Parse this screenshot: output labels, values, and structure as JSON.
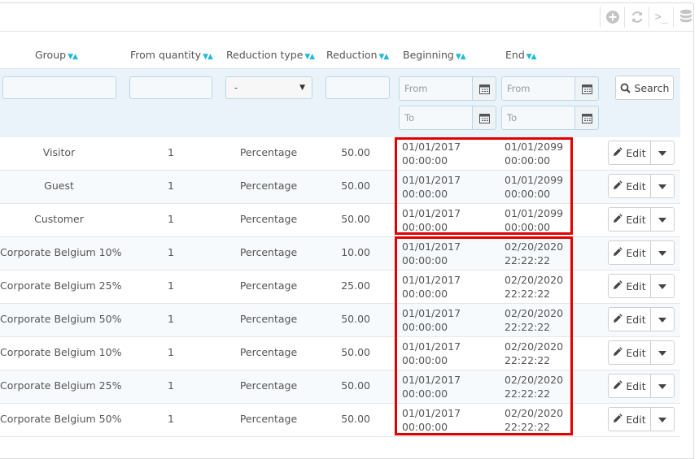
{
  "columns": {
    "group": "Group",
    "from_quantity": "From quantity",
    "reduction_type": "Reduction type",
    "reduction": "Reduction",
    "beginning": "Beginning",
    "end": "End"
  },
  "filters": {
    "reduction_type_selected": "-",
    "beginning_from_placeholder": "From",
    "beginning_to_placeholder": "To",
    "end_from_placeholder": "From",
    "end_to_placeholder": "To",
    "search_label": "Search"
  },
  "toolbar": {
    "icons": [
      "add-icon",
      "refresh-icon",
      "terminal-icon",
      "database-icon"
    ],
    "terminal_glyph": ">_"
  },
  "row_action_label": "Edit",
  "rows": [
    {
      "group": "Visitor",
      "qty": "1",
      "type": "Percentage",
      "reduction": "50.00",
      "beg_date": "01/01/2017",
      "beg_time": "00:00:00",
      "end_date": "01/01/2099",
      "end_time": "00:00:00"
    },
    {
      "group": "Guest",
      "qty": "1",
      "type": "Percentage",
      "reduction": "50.00",
      "beg_date": "01/01/2017",
      "beg_time": "00:00:00",
      "end_date": "01/01/2099",
      "end_time": "00:00:00"
    },
    {
      "group": "Customer",
      "qty": "1",
      "type": "Percentage",
      "reduction": "50.00",
      "beg_date": "01/01/2017",
      "beg_time": "00:00:00",
      "end_date": "01/01/2099",
      "end_time": "00:00:00"
    },
    {
      "group": "Corporate Belgium 10%",
      "qty": "1",
      "type": "Percentage",
      "reduction": "10.00",
      "beg_date": "01/01/2017",
      "beg_time": "00:00:00",
      "end_date": "02/20/2020",
      "end_time": "22:22:22"
    },
    {
      "group": "Corporate Belgium 25%",
      "qty": "1",
      "type": "Percentage",
      "reduction": "25.00",
      "beg_date": "01/01/2017",
      "beg_time": "00:00:00",
      "end_date": "02/20/2020",
      "end_time": "22:22:22"
    },
    {
      "group": "Corporate Belgium 50%",
      "qty": "1",
      "type": "Percentage",
      "reduction": "50.00",
      "beg_date": "01/01/2017",
      "beg_time": "00:00:00",
      "end_date": "02/20/2020",
      "end_time": "22:22:22"
    },
    {
      "group": "Corporate Belgium 10%",
      "qty": "1",
      "type": "Percentage",
      "reduction": "50.00",
      "beg_date": "01/01/2017",
      "beg_time": "00:00:00",
      "end_date": "02/20/2020",
      "end_time": "22:22:22"
    },
    {
      "group": "Corporate Belgium 25%",
      "qty": "1",
      "type": "Percentage",
      "reduction": "50.00",
      "beg_date": "01/01/2017",
      "beg_time": "00:00:00",
      "end_date": "02/20/2020",
      "end_time": "22:22:22"
    },
    {
      "group": "Corporate Belgium 50%",
      "qty": "1",
      "type": "Percentage",
      "reduction": "50.00",
      "beg_date": "01/01/2017",
      "beg_time": "00:00:00",
      "end_date": "02/20/2020",
      "end_time": "22:22:22"
    }
  ],
  "colors": {
    "accent": "#25b9d7",
    "highlight": "#e00000",
    "filter_band": "#eaf3f9"
  }
}
